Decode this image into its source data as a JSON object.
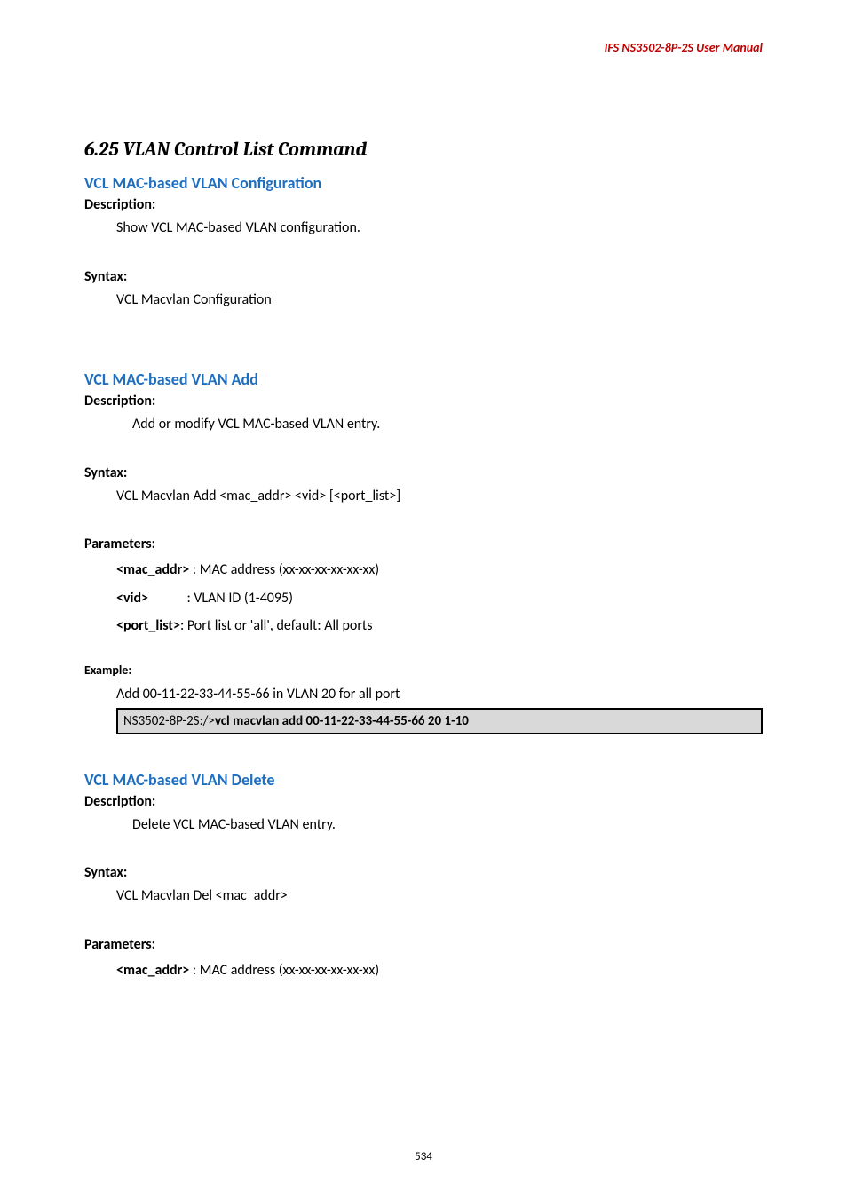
{
  "running_header": "IFS  NS3502-8P-2S  User  Manual",
  "section_title": "6.25 VLAN Control List Command",
  "cmd1": {
    "title": "VCL MAC-based VLAN Configuration",
    "desc_label": "Description:",
    "desc_text": "Show VCL MAC-based VLAN configuration.",
    "syntax_label": "Syntax:",
    "syntax_text": "VCL Macvlan Configuration"
  },
  "cmd2": {
    "title": "VCL MAC-based VLAN Add",
    "desc_label": "Description:",
    "desc_text": "Add or modify VCL MAC-based VLAN entry.",
    "syntax_label": "Syntax:",
    "syntax_text": "VCL Macvlan Add <mac_addr> <vid> [<port_list>]",
    "params_label": "Parameters:",
    "p1_name": "<mac_addr>",
    "p1_desc": " : MAC address (xx-xx-xx-xx-xx-xx)",
    "p2_name": "<vid>",
    "p2_desc": "            : VLAN ID (1-4095)",
    "p3_name": "<port_list>",
    "p3_desc": ": Port list or 'all', default: All ports",
    "example_label": "Example:",
    "example_text": "Add 00-11-22-33-44-55-66 in VLAN 20 for all port",
    "code_prefix": "NS3502-8P-2S:/>",
    "code_bold": "vcl macvlan add 00-11-22-33-44-55-66 20 1-10"
  },
  "cmd3": {
    "title": "VCL MAC-based VLAN Delete",
    "desc_label": "Description:",
    "desc_text": "Delete VCL MAC-based VLAN entry.",
    "syntax_label": "Syntax:",
    "syntax_text": "VCL Macvlan Del <mac_addr>",
    "params_label": "Parameters:",
    "p1_name": "<mac_addr>",
    "p1_desc": " : MAC address (xx-xx-xx-xx-xx-xx)"
  },
  "page_number": "534"
}
